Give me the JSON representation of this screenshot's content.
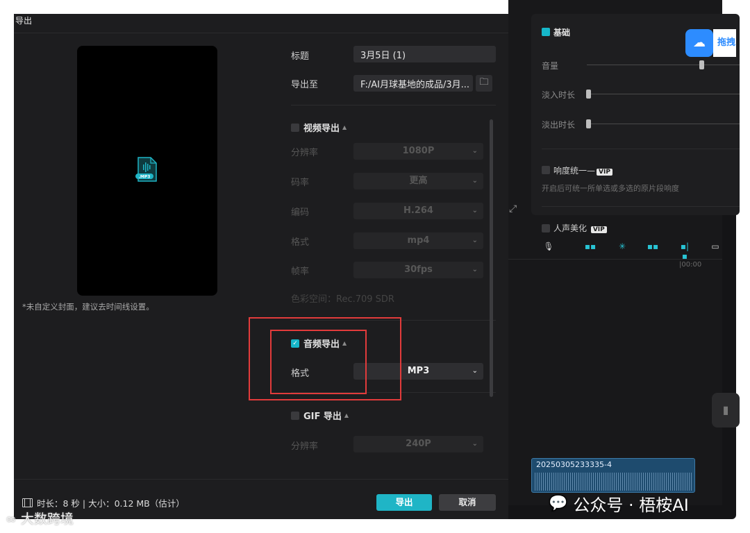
{
  "dialog": {
    "title": "导出",
    "cover_note": "*未自定义封面，建议去时间线设置。",
    "title_label": "标题",
    "title_value": "3月5日 (1)",
    "export_to_label": "导出至",
    "export_to_value": "F:/AI月球基地的成品/3月...",
    "video_section": {
      "label": "视频导出",
      "checked": false,
      "fields": [
        {
          "label": "分辨率",
          "value": "1080P"
        },
        {
          "label": "码率",
          "value": "更高"
        },
        {
          "label": "编码",
          "value": "H.264"
        },
        {
          "label": "格式",
          "value": "mp4"
        },
        {
          "label": "帧率",
          "value": "30fps"
        }
      ],
      "color_space": "色彩空间：Rec.709 SDR"
    },
    "audio_section": {
      "label": "音频导出",
      "checked": true,
      "format_label": "格式",
      "format_value": "MP3"
    },
    "gif_section": {
      "label": "GIF 导出",
      "checked": false,
      "resolution_label": "分辨率",
      "resolution_value": "240P"
    },
    "preview_icon_label": ".MP3",
    "footer_info": "时长：8 秒 | 大小：0.12 MB（估计）",
    "export_button": "导出",
    "cancel_button": "取消"
  },
  "editor": {
    "basic_label": "基础",
    "volume_label": "音量",
    "fade_in_label": "淡入时长",
    "fade_out_label": "淡出时长",
    "loudness_label": "响度统一",
    "loudness_desc": "开启后可统一所单选或多选的原片段响度",
    "voice_label": "人声美化",
    "vip": "VIP",
    "ruler_time": "|00:00",
    "clip_name": "20250305233335-4",
    "share_text": "拖拽"
  },
  "watermarks": {
    "wechat": "公众号 · 梧桉AI",
    "bottom_left": "大数跨境"
  },
  "colors": {
    "accent": "#1fb5c6",
    "highlight": "#e23b3b"
  }
}
